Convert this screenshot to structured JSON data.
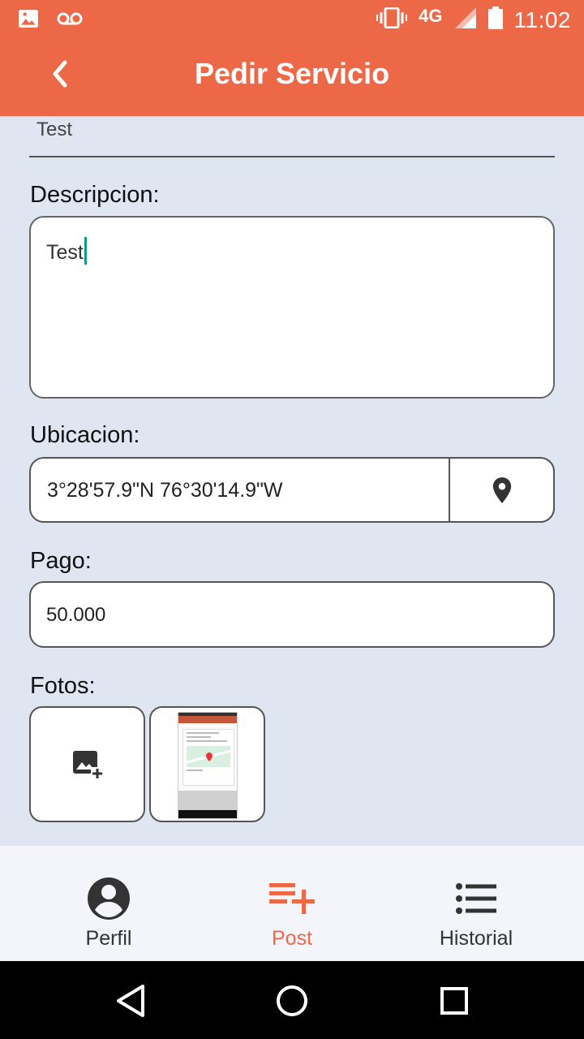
{
  "status_bar": {
    "network": "4G",
    "time": "11:02"
  },
  "app_bar": {
    "title": "Pedir Servicio"
  },
  "form": {
    "title_value": "Test",
    "descripcion_label": "Descripcion:",
    "descripcion_value": "Test",
    "ubicacion_label": "Ubicacion:",
    "ubicacion_value": "3°28'57.9\"N 76°30'14.9\"W",
    "pago_label": "Pago:",
    "pago_value": "50.000",
    "fotos_label": "Fotos:"
  },
  "bottom_nav": {
    "items": [
      {
        "label": "Perfil",
        "icon": "account-circle-icon",
        "active": false
      },
      {
        "label": "Post",
        "icon": "playlist-add-icon",
        "active": true
      },
      {
        "label": "Historial",
        "icon": "list-icon",
        "active": false
      }
    ]
  },
  "colors": {
    "primary": "#ec6847",
    "background": "#dfe5f1",
    "cursor": "#119a8a"
  }
}
